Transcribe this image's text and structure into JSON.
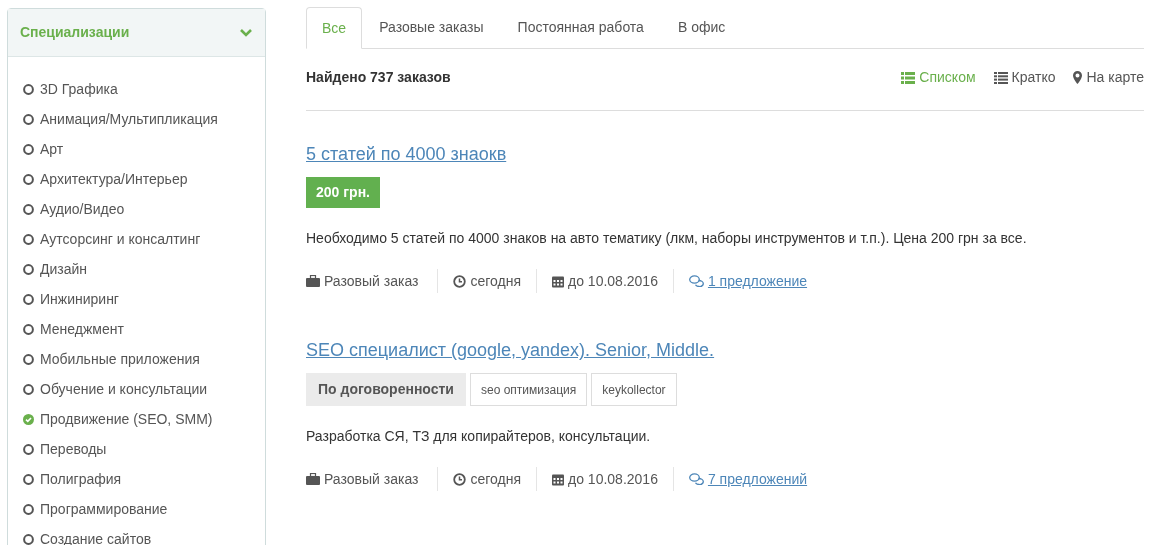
{
  "sidebar": {
    "title": "Специализации",
    "expanded": true,
    "items": [
      {
        "label": "3D Графика",
        "checked": false
      },
      {
        "label": "Анимация/Мультипликация",
        "checked": false
      },
      {
        "label": "Арт",
        "checked": false
      },
      {
        "label": "Архитектура/Интерьер",
        "checked": false
      },
      {
        "label": "Аудио/Видео",
        "checked": false
      },
      {
        "label": "Аутсорсинг и консалтинг",
        "checked": false
      },
      {
        "label": "Дизайн",
        "checked": false
      },
      {
        "label": "Инжиниринг",
        "checked": false
      },
      {
        "label": "Менеджмент",
        "checked": false
      },
      {
        "label": "Мобильные приложения",
        "checked": false
      },
      {
        "label": "Обучение и консультации",
        "checked": false
      },
      {
        "label": "Продвижение (SEO, SMM)",
        "checked": true
      },
      {
        "label": "Переводы",
        "checked": false
      },
      {
        "label": "Полиграфия",
        "checked": false
      },
      {
        "label": "Программирование",
        "checked": false
      },
      {
        "label": "Создание сайтов",
        "checked": false
      }
    ]
  },
  "tabs": [
    {
      "label": "Все",
      "selected": true
    },
    {
      "label": "Разовые заказы",
      "selected": false
    },
    {
      "label": "Постоянная работа",
      "selected": false
    },
    {
      "label": "В офис",
      "selected": false
    }
  ],
  "found": "Найдено 737 заказов",
  "views": [
    {
      "kind": "list",
      "label": "Списком",
      "selected": true
    },
    {
      "kind": "brief",
      "label": "Кратко",
      "selected": false
    },
    {
      "kind": "map",
      "label": "На карте",
      "selected": false
    }
  ],
  "orders": [
    {
      "title": "5 статей по 4000 знаокв",
      "badges": [
        {
          "kind": "price",
          "text": "200 грн."
        }
      ],
      "description": "Необходимо 5 статей по 4000 знаков на авто тематику (лкм, наборы инструментов и т.п.). Цена 200 грн за все.",
      "type": "Разовый заказ",
      "posted": "сегодня",
      "deadline": "до 10.08.2016",
      "offers": "1 предложение"
    },
    {
      "title": "SEO специалист (google, yandex). Senior, Middle.",
      "badges": [
        {
          "kind": "negotiable",
          "text": "По договоренности"
        },
        {
          "kind": "tag",
          "text": "seo оптимизация"
        },
        {
          "kind": "tag",
          "text": "keykollector"
        }
      ],
      "description": "Разработка СЯ, ТЗ для копирайтеров, консультации.",
      "type": "Разовый заказ",
      "posted": "сегодня",
      "deadline": "до 10.08.2016",
      "offers": "7 предложений"
    }
  ]
}
